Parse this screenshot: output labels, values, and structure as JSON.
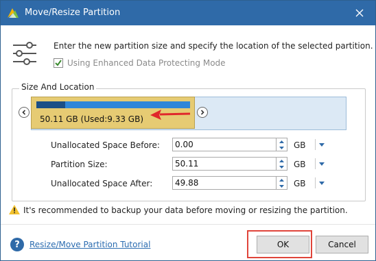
{
  "window": {
    "title": "Move/Resize Partition",
    "icons": {
      "app": "app-logo-icon",
      "close": "close-icon"
    }
  },
  "intro": {
    "icon": "settings-sliders-icon",
    "text": "Enter the new partition size and specify the location of the selected partition.",
    "protect_label": "Using Enhanced Data Protecting Mode",
    "protect_checked": true
  },
  "size_and_location": {
    "group_title": "Size And Location",
    "partition_label": "50.11 GB (Used:9.33 GB)",
    "used_fraction": 0.186,
    "partition_fraction": 0.52,
    "colors": {
      "partition": "#e6cb73",
      "used": "#1c4f86",
      "track": "#2f86d8",
      "unallocated": "#dce9f5",
      "arrow": "#e0272b"
    },
    "fields": [
      {
        "label": "Unallocated Space Before:",
        "value": "0.00",
        "unit": "GB"
      },
      {
        "label": "Partition Size:",
        "value": "50.11",
        "unit": "GB"
      },
      {
        "label": "Unallocated Space After:",
        "value": "49.88",
        "unit": "GB"
      }
    ]
  },
  "warning": {
    "icon": "warning-icon",
    "text": "It's recommended to backup your data before moving or resizing the partition."
  },
  "footer": {
    "help_icon": "help-icon",
    "help_link": "Resize/Move Partition Tutorial",
    "ok_label": "OK",
    "cancel_label": "Cancel",
    "highlight_color": "#e0443a"
  }
}
